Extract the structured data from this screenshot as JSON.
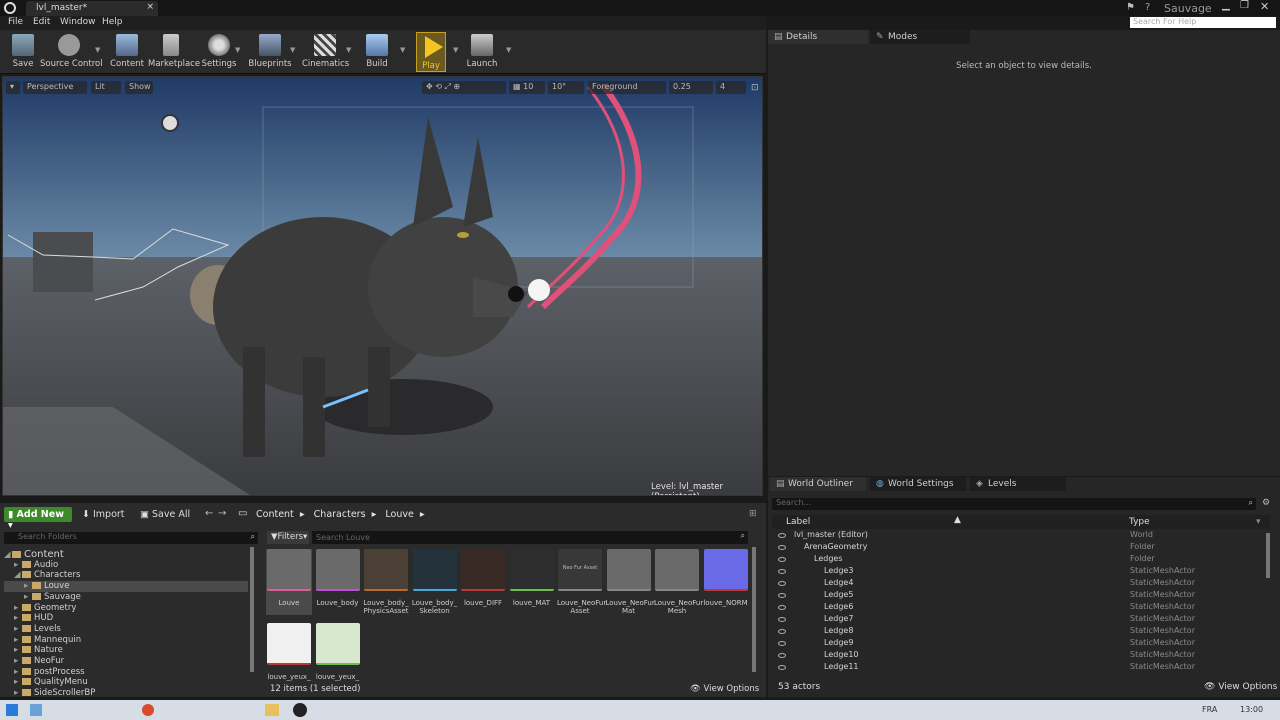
{
  "window": {
    "tab_title": "lvl_master*",
    "project_name": "Sauvage",
    "help_search_placeholder": "Search For Help"
  },
  "menu": [
    "File",
    "Edit",
    "Window",
    "Help"
  ],
  "toolbar": [
    {
      "label": "Save",
      "icon": "save-icon"
    },
    {
      "label": "Source Control",
      "icon": "source-control-icon"
    },
    {
      "label": "Content",
      "icon": "content-icon"
    },
    {
      "label": "Marketplace",
      "icon": "marketplace-icon"
    },
    {
      "label": "Settings",
      "icon": "settings-icon"
    },
    {
      "label": "Blueprints",
      "icon": "blueprints-icon"
    },
    {
      "label": "Cinematics",
      "icon": "cinematics-icon"
    },
    {
      "label": "Build",
      "icon": "build-icon"
    },
    {
      "label": "Play",
      "icon": "play-icon"
    },
    {
      "label": "Launch",
      "icon": "launch-icon"
    }
  ],
  "viewport": {
    "perspective": "Perspective",
    "lit": "Lit",
    "show": "Show",
    "grid_snap": "10",
    "rot_snap": "10°",
    "foreground": "Foreground",
    "scale_snap": "0.25",
    "cam_speed": "4",
    "level_prefix": "Level:",
    "level_name": "lvl_master (Persistent)"
  },
  "details": {
    "tab_details": "Details",
    "tab_modes": "Modes",
    "empty_message": "Select an object to view details."
  },
  "content_browser": {
    "add_new": "Add New",
    "import": "Import",
    "save_all": "Save All",
    "breadcrumb": [
      "Content",
      "Characters",
      "Louve"
    ],
    "search_folders_placeholder": "Search Folders",
    "filters": "Filters",
    "search_placeholder": "Search Louve",
    "folders": [
      {
        "name": "Content",
        "level": 0,
        "open": true
      },
      {
        "name": "Audio",
        "level": 1
      },
      {
        "name": "Characters",
        "level": 1,
        "open": true
      },
      {
        "name": "Louve",
        "level": 2,
        "selected": true
      },
      {
        "name": "Sauvage",
        "level": 2
      },
      {
        "name": "Geometry",
        "level": 1
      },
      {
        "name": "HUD",
        "level": 1
      },
      {
        "name": "Levels",
        "level": 1
      },
      {
        "name": "Mannequin",
        "level": 1
      },
      {
        "name": "Nature",
        "level": 1
      },
      {
        "name": "NeoFur",
        "level": 1
      },
      {
        "name": "postProcess",
        "level": 1
      },
      {
        "name": "QualityMenu",
        "level": 1
      },
      {
        "name": "SideScrollerBP",
        "level": 1
      }
    ],
    "assets": [
      {
        "name": "Louve",
        "color": "#6a6a6a",
        "strip": "#e05c9a"
      },
      {
        "name": "Louve_body",
        "color": "#6a6a6a",
        "strip": "#c04ed8"
      },
      {
        "name": "Louve_body_ PhysicsAsset",
        "color": "#4a4035",
        "strip": "#c06a2a"
      },
      {
        "name": "Louve_body_ Skeleton",
        "color": "#24323c",
        "strip": "#4aa8d8"
      },
      {
        "name": "louve_DIFF",
        "color": "#3a2a25",
        "strip": "#b83a3a"
      },
      {
        "name": "louve_MAT",
        "color": "#2e2e2e",
        "strip": "#6ac04a"
      },
      {
        "name": "Louve_NeoFur Asset",
        "color": "#383838",
        "strip": "#888888",
        "thumb_text": "Neo Fur Asset"
      },
      {
        "name": "Louve_NeoFur Mat",
        "color": "#6a6a6a",
        "strip": "#888888"
      },
      {
        "name": "Louve_NeoFur Mesh",
        "color": "#6a6a6a",
        "strip": "#888888"
      },
      {
        "name": "louve_NORM",
        "color": "#6a6ae6",
        "strip": "#b83a3a"
      },
      {
        "name": "louve_yeux_",
        "color": "#f0f0f0",
        "strip": "#b83a3a"
      },
      {
        "name": "louve_yeux_",
        "color": "#d8e8d0",
        "strip": "#6ac04a"
      }
    ],
    "item_count": "12 items (1 selected)",
    "view_options": "View Options"
  },
  "outliner": {
    "tabs": [
      "World Outliner",
      "World Settings",
      "Levels"
    ],
    "search_placeholder": "Search...",
    "col_label": "Label",
    "col_type": "Type",
    "rows": [
      {
        "label": "lvl_master (Editor)",
        "type": "World",
        "indent": 0
      },
      {
        "label": "ArenaGeometry",
        "type": "Folder",
        "indent": 1
      },
      {
        "label": "Ledges",
        "type": "Folder",
        "indent": 2
      },
      {
        "label": "Ledge3",
        "type": "StaticMeshActor",
        "indent": 3
      },
      {
        "label": "Ledge4",
        "type": "StaticMeshActor",
        "indent": 3
      },
      {
        "label": "Ledge5",
        "type": "StaticMeshActor",
        "indent": 3
      },
      {
        "label": "Ledge6",
        "type": "StaticMeshActor",
        "indent": 3
      },
      {
        "label": "Ledge7",
        "type": "StaticMeshActor",
        "indent": 3
      },
      {
        "label": "Ledge8",
        "type": "StaticMeshActor",
        "indent": 3
      },
      {
        "label": "Ledge9",
        "type": "StaticMeshActor",
        "indent": 3
      },
      {
        "label": "Ledge10",
        "type": "StaticMeshActor",
        "indent": 3
      },
      {
        "label": "Ledge11",
        "type": "StaticMeshActor",
        "indent": 3
      }
    ],
    "actor_count": "53 actors",
    "view_options": "View Options"
  },
  "taskbar": {
    "lang": "FRA",
    "time": "13:00"
  }
}
